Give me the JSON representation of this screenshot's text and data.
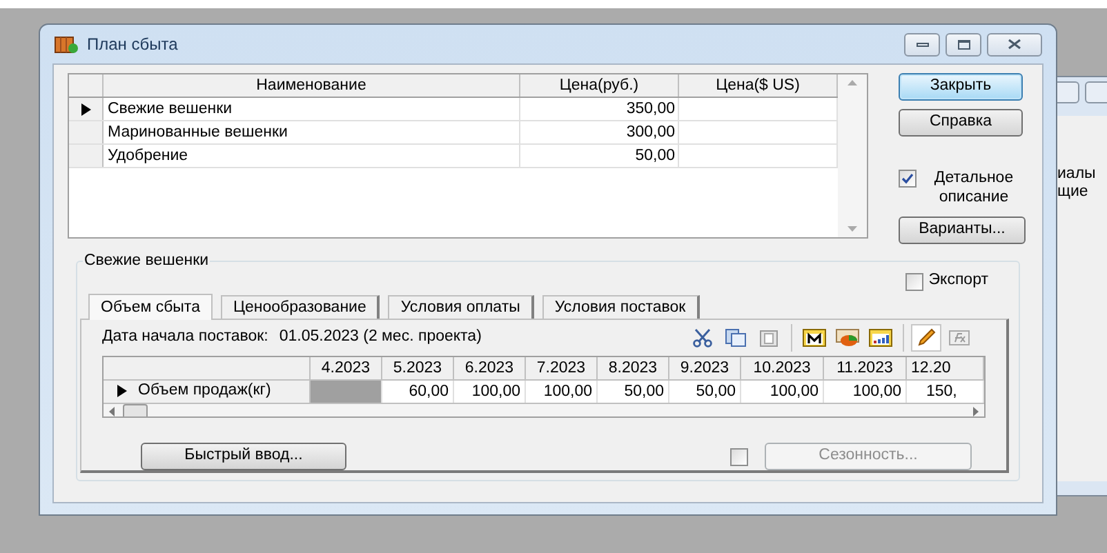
{
  "background_window": {
    "texts": [
      "иалы",
      "щие"
    ]
  },
  "window": {
    "title": "План сбыта"
  },
  "products": {
    "columns": [
      "Наименование",
      "Цена(руб.)",
      "Цена($ US)"
    ],
    "rows": [
      {
        "cells": [
          "Свежие вешенки",
          "350,00",
          ""
        ],
        "selected": true
      },
      {
        "cells": [
          "Маринованные вешенки",
          "300,00",
          ""
        ],
        "selected": false
      },
      {
        "cells": [
          "Удобрение",
          "50,00",
          ""
        ],
        "selected": false
      }
    ]
  },
  "side": {
    "close_button": "Закрыть",
    "help_button": "Справка",
    "detail": {
      "label": "Детальное описание",
      "checked": true
    },
    "variants_button": "Варианты..."
  },
  "group": {
    "title": "Свежие вешенки",
    "export": {
      "label": "Экспорт",
      "checked": false
    },
    "tabs": [
      {
        "label": "Объем сбыта",
        "selected": true
      },
      {
        "label": "Ценообразование",
        "selected": false
      },
      {
        "label": "Условия оплаты",
        "selected": false
      },
      {
        "label": "Условия поставок",
        "selected": false
      }
    ],
    "date_label": "Дата начала поставок:",
    "date_value": "01.05.2023 (2 мес. проекта)",
    "toolbar": [
      {
        "kind": "cut",
        "pressed": false
      },
      {
        "kind": "copy",
        "pressed": false
      },
      {
        "kind": "paste",
        "pressed": false
      },
      {
        "kind": "sep"
      },
      {
        "kind": "calendar",
        "pressed": false
      },
      {
        "kind": "pie",
        "pressed": false
      },
      {
        "kind": "chart",
        "pressed": false
      },
      {
        "kind": "sep"
      },
      {
        "kind": "pencil",
        "pressed": true
      },
      {
        "kind": "formula",
        "pressed": false
      }
    ],
    "volume": {
      "columns": [
        "4.2023",
        "5.2023",
        "6.2023",
        "7.2023",
        "8.2023",
        "9.2023",
        "10.2023",
        "11.2023",
        "12.20"
      ],
      "rows": [
        {
          "label": "Объем продаж(кг)",
          "selected": true,
          "cells": [
            null,
            "60,00",
            "100,00",
            "100,00",
            "50,00",
            "50,00",
            "100,00",
            "100,00",
            "150,"
          ]
        }
      ]
    },
    "quick_button": "Быстрый ввод...",
    "seasonality": {
      "checked": false,
      "label": "Сезонность...",
      "disabled": true
    }
  }
}
